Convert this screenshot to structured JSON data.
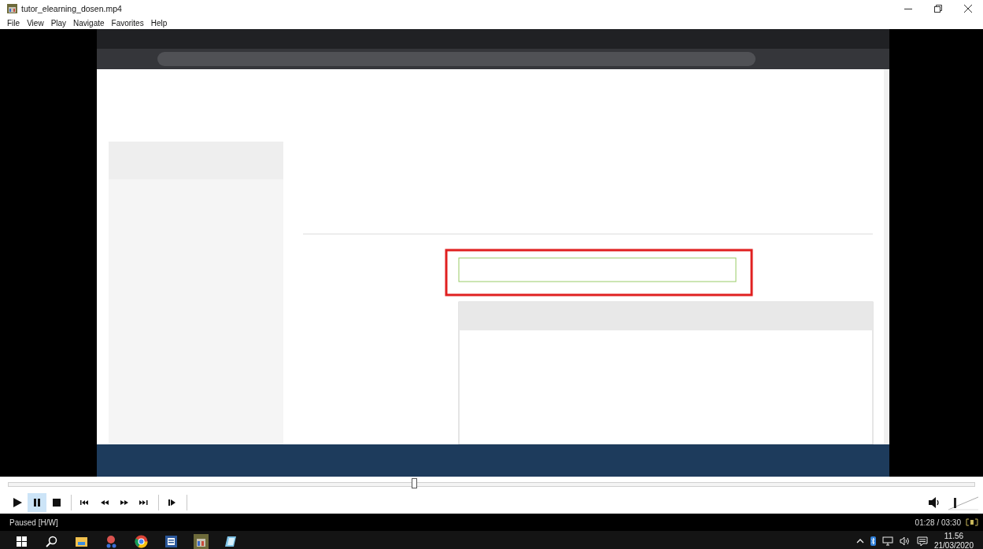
{
  "window": {
    "title": "tutor_elearning_dosen.mp4"
  },
  "menu": [
    "File",
    "View",
    "Play",
    "Navigate",
    "Favorites",
    "Help"
  ],
  "seek": {
    "level": 0.42
  },
  "controls": [
    {
      "kind": "play",
      "selected": false
    },
    {
      "kind": "pause",
      "selected": true
    },
    {
      "kind": "stop",
      "selected": false
    },
    {
      "kind": "previous",
      "selected": false
    },
    {
      "kind": "rewind",
      "selected": false
    },
    {
      "kind": "forward",
      "selected": false
    },
    {
      "kind": "next",
      "selected": false
    },
    {
      "kind": "frame-step",
      "selected": false
    }
  ],
  "volume": {
    "level": 0.2
  },
  "status": {
    "text": "Paused [H/W]",
    "time": "01:28 / 03:30"
  },
  "taskbar": {
    "time": "11.56",
    "date": "21/03/2020"
  }
}
